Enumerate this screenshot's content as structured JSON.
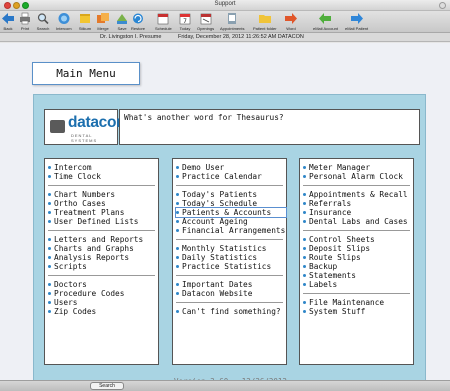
{
  "window": {
    "title": "Support"
  },
  "toolbar": {
    "items": [
      {
        "label": "Back",
        "icon": "back-arrow-icon"
      },
      {
        "label": "Print",
        "icon": "printer-icon"
      },
      {
        "label": "Search",
        "icon": "magnifier-icon"
      },
      {
        "label": "Intercom",
        "icon": "intercom-icon"
      },
      {
        "label": "Stikum",
        "icon": "sticky-note-icon"
      },
      {
        "label": "Merge",
        "icon": "merge-icon"
      },
      {
        "label": "Save",
        "icon": "save-icon"
      },
      {
        "label": "Restore",
        "icon": "restore-icon"
      },
      {
        "label": "Schedule",
        "icon": "schedule-icon"
      },
      {
        "label": "Today",
        "icon": "calendar-icon"
      },
      {
        "label": "Openings",
        "icon": "openings-icon"
      },
      {
        "label": "Appointments",
        "icon": "appointments-icon"
      },
      {
        "label": "Patient folder",
        "icon": "folder-icon"
      },
      {
        "label": "Word",
        "icon": "word-arrow-icon"
      },
      {
        "label": "eMail Account",
        "icon": "green-arrow-icon"
      },
      {
        "label": "eMail Patient",
        "icon": "blue-arrow-icon"
      }
    ]
  },
  "info": {
    "user": "Dr. Livingston I. Presume",
    "datetime": "Friday, December 28, 2012  11:26:52 AM  DATACON"
  },
  "main_menu_label": "Main Menu",
  "logo": {
    "word": "datacon",
    "sub": "DENTAL SYSTEMS"
  },
  "question": "What's another word for Thesaurus?",
  "columns": [
    [
      [
        "Intercom",
        "Time Clock"
      ],
      [
        "Chart Numbers",
        "Ortho Cases",
        "Treatment Plans",
        "User Defined Lists"
      ],
      [
        "Letters and Reports",
        "Charts and Graphs",
        "Analysis Reports",
        "Scripts"
      ],
      [
        "Doctors",
        "Procedure Codes",
        "Users",
        "Zip Codes"
      ]
    ],
    [
      [
        "Demo User",
        "Practice Calendar"
      ],
      [
        "Today's Patients",
        "Today's Schedule",
        "Patients & Accounts",
        "Account Ageing",
        "Financial Arrangements"
      ],
      [
        "Monthly Statistics",
        "Daily Statistics",
        "Practice Statistics"
      ],
      [
        "Important Dates",
        "Datacon Website"
      ],
      [
        "Can't find something?"
      ]
    ],
    [
      [
        "Meter Manager",
        "Personal Alarm Clock"
      ],
      [
        "Appointments & Recall",
        "Referrals",
        "Insurance",
        "Dental Labs and Cases"
      ],
      [
        "Control Sheets",
        "Deposit Slips",
        "Route Slips",
        "Backup",
        "Statements",
        "Labels"
      ],
      [
        "File Maintenance",
        "System Stuff"
      ]
    ]
  ],
  "highlighted_item": "Patients & Accounts",
  "version": "Version 3.60 - 12/26/2012",
  "status": {
    "search_label": "Search"
  },
  "colors": {
    "panel": "#a9d4e3",
    "accent": "#2f86c8",
    "logo": "#1c6fae"
  }
}
